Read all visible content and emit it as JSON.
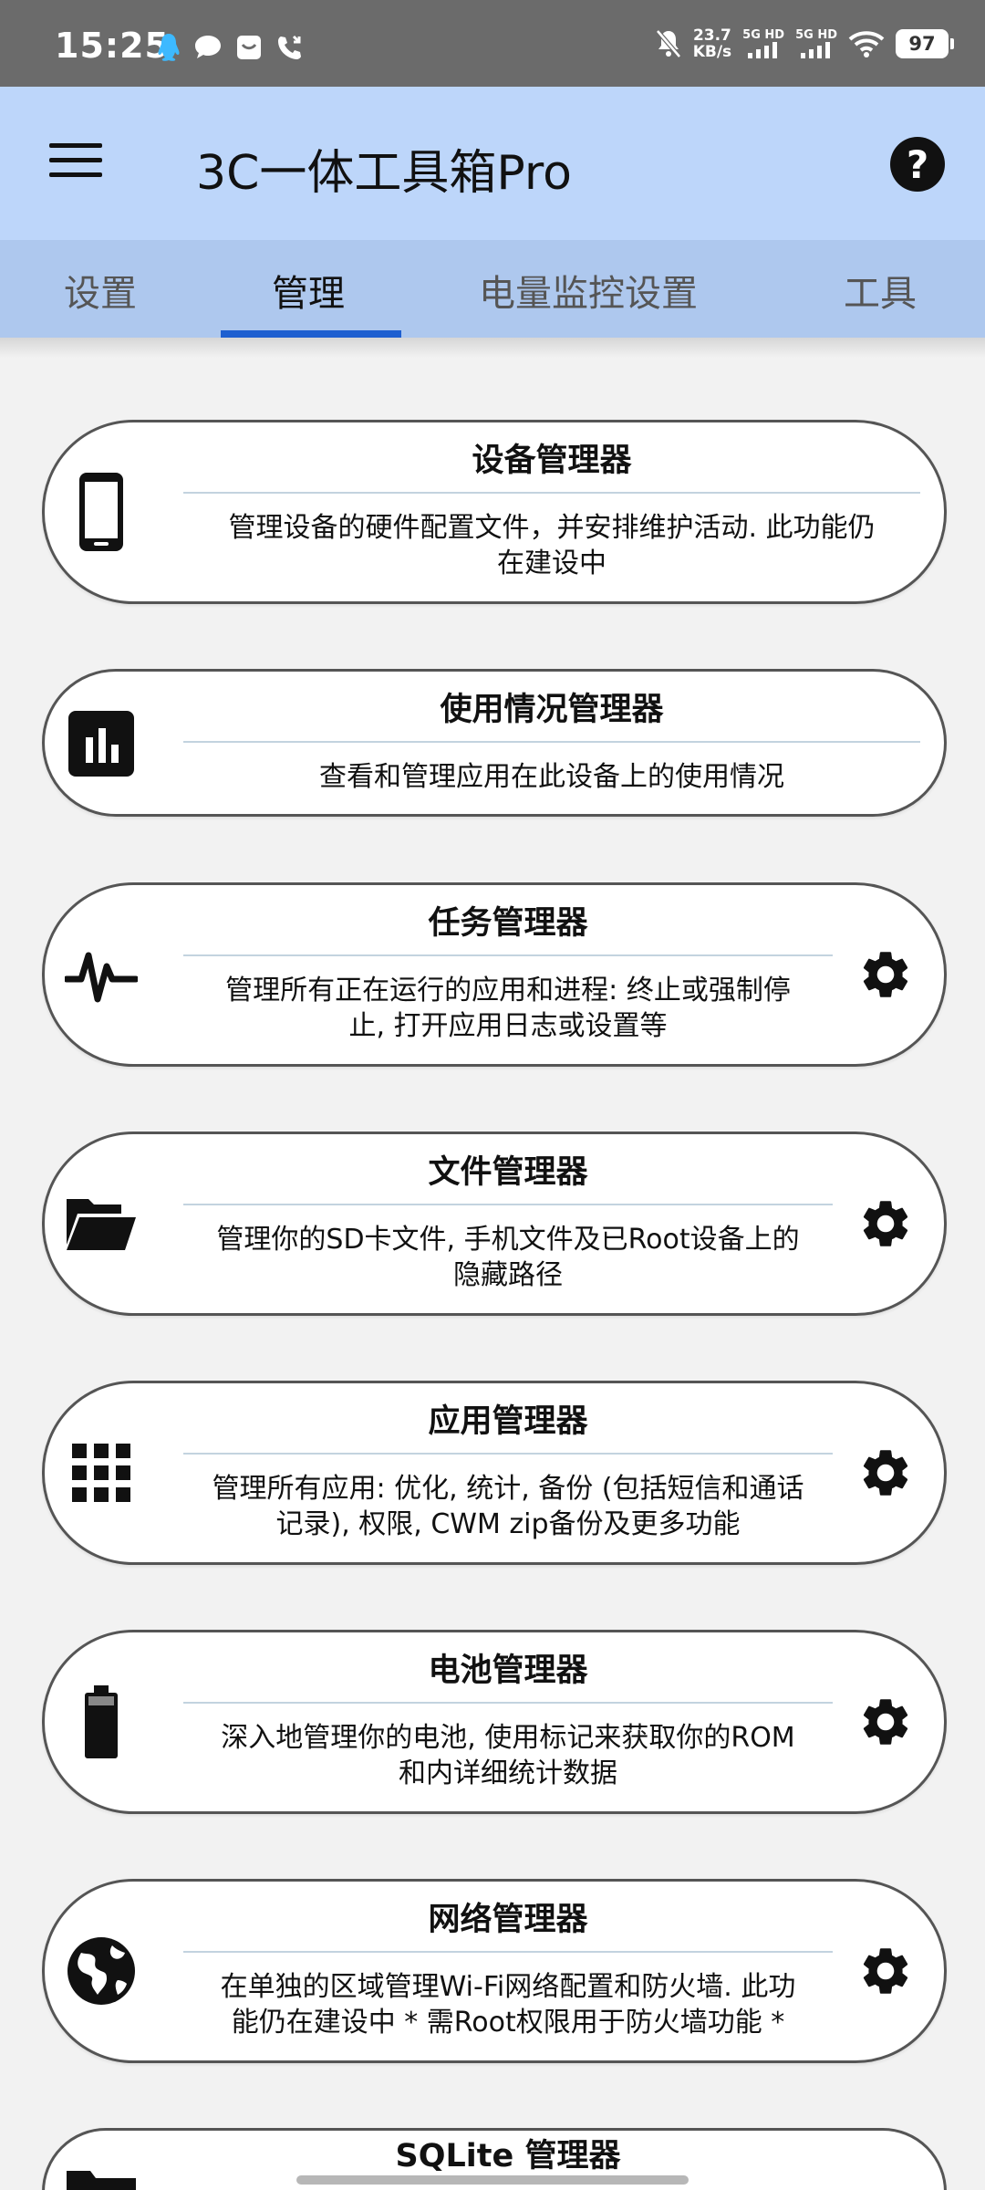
{
  "status_bar": {
    "time": "15:25",
    "speed_value": "23.7",
    "speed_unit": "KB/s",
    "net1": "5G HD",
    "net2": "5G HD",
    "battery": "97"
  },
  "app_bar": {
    "title": "3C一体工具箱Pro",
    "menu_icon": "hamburger-menu-icon",
    "help_icon": "help-icon",
    "help_glyph": "?"
  },
  "tabs": [
    {
      "label": "设置",
      "active": false
    },
    {
      "label": "管理",
      "active": true
    },
    {
      "label": "电量监控设置",
      "active": false
    },
    {
      "label": "工具",
      "active": false
    }
  ],
  "colors": {
    "app_bar": "#bdd6fa",
    "tab_bar": "#aec8ee",
    "tab_indicator": "#1e5fd0",
    "status_bar": "#6b6b6b"
  },
  "cards": [
    {
      "title": "设备管理器",
      "desc_line1": "管理设备的硬件配置文件，并安排维护活动. 此功能仍",
      "desc_line2": "在建设中",
      "icon": "smartphone-icon",
      "has_settings": false
    },
    {
      "title": "使用情况管理器",
      "desc_line1": "查看和管理应用在此设备上的使用情况",
      "desc_line2": "",
      "icon": "bar-chart-icon",
      "has_settings": false
    },
    {
      "title": "任务管理器",
      "desc_line1": "管理所有正在运行的应用和进程: 终止或强制停",
      "desc_line2": "止, 打开应用日志或设置等",
      "icon": "pulse-icon",
      "has_settings": true
    },
    {
      "title": "文件管理器",
      "desc_line1": "管理你的SD卡文件, 手机文件及已Root设备上的",
      "desc_line2": "隐藏路径",
      "icon": "folder-open-icon",
      "has_settings": true
    },
    {
      "title": "应用管理器",
      "desc_line1": "管理所有应用: 优化, 统计, 备份 (包括短信和通话",
      "desc_line2": "记录), 权限, CWM zip备份及更多功能",
      "icon": "apps-grid-icon",
      "has_settings": true
    },
    {
      "title": "电池管理器",
      "desc_line1": "深入地管理你的电池, 使用标记来获取你的ROM",
      "desc_line2": "和内详细统计数据",
      "icon": "battery-icon",
      "has_settings": true
    },
    {
      "title": "网络管理器",
      "desc_line1": "在单独的区域管理Wi-Fi网络配置和防火墙. 此功",
      "desc_line2": "能仍在建设中 * 需Root权限用于防火墙功能 *",
      "icon": "globe-icon",
      "has_settings": true
    },
    {
      "title": "SQLite 管理器",
      "desc_line1": "",
      "desc_line2": "",
      "icon": "folder-icon",
      "has_settings": false
    }
  ]
}
